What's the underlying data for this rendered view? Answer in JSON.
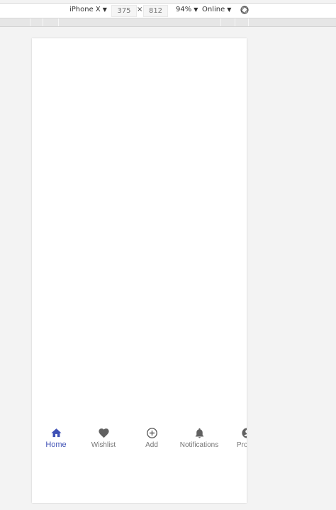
{
  "devtools": {
    "device": "iPhone X",
    "width": "375",
    "times": "×",
    "height": "812",
    "zoom": "94%",
    "network": "Online",
    "caret": "▼"
  },
  "colors": {
    "accent": "#3f51b5",
    "inactive": "#757575"
  },
  "bottom_nav": {
    "items": [
      {
        "label": "Home",
        "icon": "home-icon",
        "active": true
      },
      {
        "label": "Wishlist",
        "icon": "heart-icon",
        "active": false
      },
      {
        "label": "Add",
        "icon": "add-circle-icon",
        "active": false
      },
      {
        "label": "Notifications",
        "icon": "bell-icon",
        "active": false
      },
      {
        "label": "Profile",
        "icon": "account-icon",
        "active": false
      }
    ]
  }
}
